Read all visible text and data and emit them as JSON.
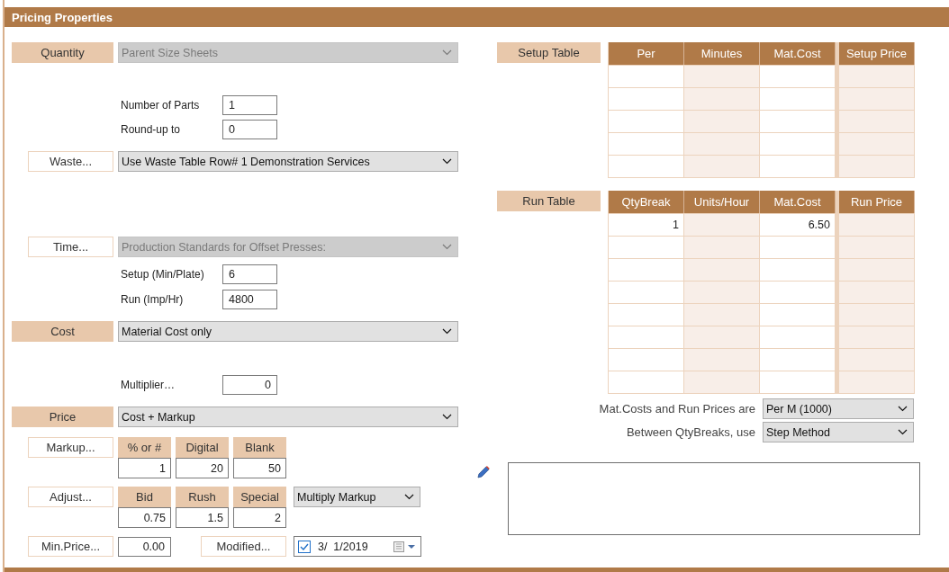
{
  "title": "Pricing Properties",
  "quantity": {
    "label": "Quantity",
    "value": "Parent Size Sheets",
    "disabled": true
  },
  "quantity_fields": [
    {
      "label": "Number of Parts",
      "value": "1",
      "kind": "text"
    },
    {
      "label": "Round-up to",
      "value": "0",
      "kind": "text"
    }
  ],
  "waste": {
    "label": "Waste...",
    "value": "Use Waste Table Row# 1  Demonstration Services",
    "disabled": false
  },
  "time": {
    "label": "Time...",
    "value": "Production Standards for Offset Presses:",
    "disabled": true
  },
  "time_fields": [
    {
      "label": "Setup (Min/Plate)",
      "value": "6",
      "kind": "text"
    },
    {
      "label": "Run (Imp/Hr)",
      "value": "4800",
      "kind": "text"
    }
  ],
  "cost": {
    "label": "Cost",
    "value": "Material Cost only",
    "disabled": false
  },
  "cost_fields": [
    {
      "label": "Multiplier…",
      "value": "0",
      "kind": "number"
    }
  ],
  "price": {
    "label": "Price",
    "value": "Cost + Markup",
    "disabled": false
  },
  "markup": {
    "label": "Markup...",
    "columns": [
      {
        "header": "% or #",
        "value": "1"
      },
      {
        "header": "Digital",
        "value": "20"
      },
      {
        "header": "Blank",
        "value": "50"
      }
    ]
  },
  "adjust": {
    "label": "Adjust...",
    "columns": [
      {
        "header": "Bid",
        "value": "0.75"
      },
      {
        "header": "Rush",
        "value": "1.5"
      },
      {
        "header": "Special",
        "value": "2"
      }
    ],
    "mode": "Multiply Markup"
  },
  "min_price": {
    "label": "Min.Price...",
    "value": "0.00"
  },
  "modified": {
    "label": "Modified...",
    "checked": true,
    "date": "3/  1/2019"
  },
  "setup_table": {
    "label": "Setup Table",
    "columns": [
      "Per",
      "Minutes",
      "Mat.Cost",
      "Setup Price"
    ],
    "rows": [
      [
        null,
        null,
        null,
        null
      ],
      [
        null,
        null,
        null,
        null
      ],
      [
        null,
        null,
        null,
        null
      ],
      [
        null,
        null,
        null,
        null
      ],
      [
        null,
        null,
        null,
        null
      ]
    ]
  },
  "run_table": {
    "label": "Run Table",
    "columns": [
      "QtyBreak",
      "Units/Hour",
      "Mat.Cost",
      "Run Price"
    ],
    "rows": [
      [
        "1",
        null,
        "6.50",
        null
      ],
      [
        null,
        null,
        null,
        null
      ],
      [
        null,
        null,
        null,
        null
      ],
      [
        null,
        null,
        null,
        null
      ],
      [
        null,
        null,
        null,
        null
      ],
      [
        null,
        null,
        null,
        null
      ],
      [
        null,
        null,
        null,
        null
      ],
      [
        null,
        null,
        null,
        null
      ]
    ]
  },
  "price_basis": {
    "label": "Mat.Costs and Run Prices are",
    "value": "Per M (1000)"
  },
  "interpolation": {
    "label": "Between QtyBreaks, use",
    "value": "Step Method"
  }
}
